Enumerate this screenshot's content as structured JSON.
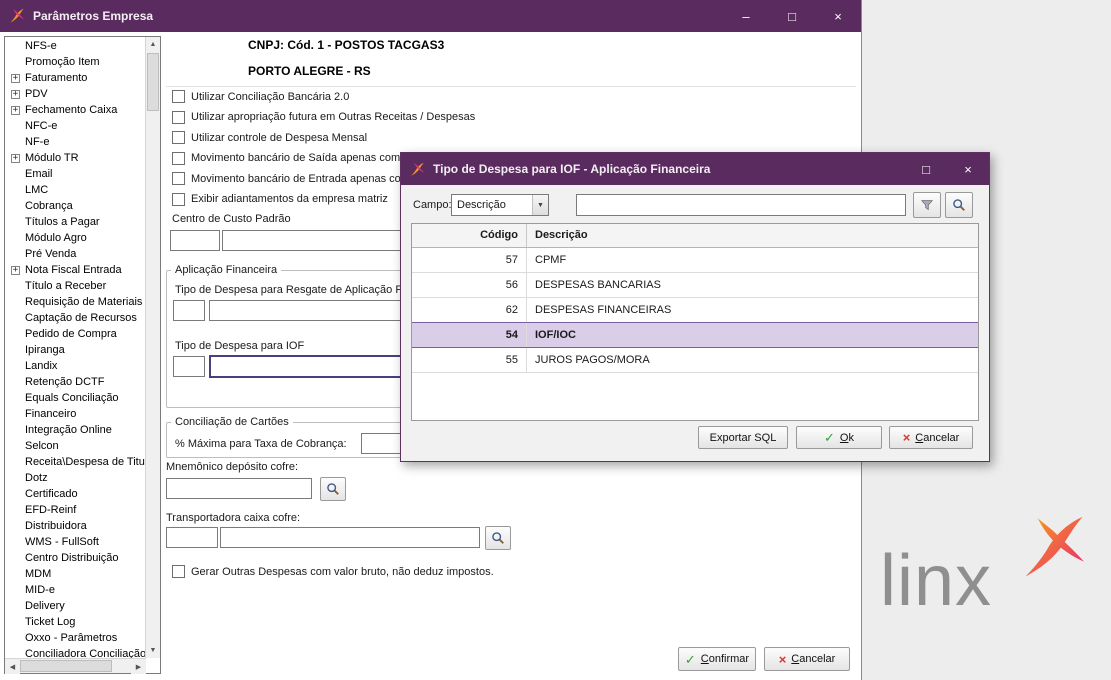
{
  "window": {
    "title": "Parâmetros Empresa",
    "minimize": "–",
    "maximize": "□",
    "close": "×"
  },
  "sidebar": {
    "items": [
      {
        "label": "NFS-e",
        "plus": false
      },
      {
        "label": "Promoção Item",
        "plus": false
      },
      {
        "label": "Faturamento",
        "plus": true
      },
      {
        "label": "PDV",
        "plus": true
      },
      {
        "label": "Fechamento Caixa",
        "plus": true
      },
      {
        "label": "NFC-e",
        "plus": false
      },
      {
        "label": "NF-e",
        "plus": false
      },
      {
        "label": "Módulo TR",
        "plus": true
      },
      {
        "label": "Email",
        "plus": false
      },
      {
        "label": "LMC",
        "plus": false
      },
      {
        "label": "Cobrança",
        "plus": false
      },
      {
        "label": "Títulos a Pagar",
        "plus": false
      },
      {
        "label": "Módulo Agro",
        "plus": false
      },
      {
        "label": "Pré Venda",
        "plus": false
      },
      {
        "label": "Nota Fiscal Entrada",
        "plus": true
      },
      {
        "label": "Título a Receber",
        "plus": false
      },
      {
        "label": "Requisição de Materiais",
        "plus": false
      },
      {
        "label": "Captação de Recursos",
        "plus": false
      },
      {
        "label": "Pedido de Compra",
        "plus": false
      },
      {
        "label": "Ipiranga",
        "plus": false
      },
      {
        "label": "Landix",
        "plus": false
      },
      {
        "label": "Retenção DCTF",
        "plus": false
      },
      {
        "label": "Equals Conciliação",
        "plus": false
      },
      {
        "label": "Financeiro",
        "plus": false
      },
      {
        "label": "Integração Online",
        "plus": false
      },
      {
        "label": "Selcon",
        "plus": false
      },
      {
        "label": "Receita\\Despesa de Titul",
        "plus": false
      },
      {
        "label": "Dotz",
        "plus": false
      },
      {
        "label": "Certificado",
        "plus": false
      },
      {
        "label": "EFD-Reinf",
        "plus": false
      },
      {
        "label": "Distribuidora",
        "plus": false
      },
      {
        "label": "WMS - FullSoft",
        "plus": false
      },
      {
        "label": "Centro Distribuição",
        "plus": false
      },
      {
        "label": "MDM",
        "plus": false
      },
      {
        "label": "MID-e",
        "plus": false
      },
      {
        "label": "Delivery",
        "plus": false
      },
      {
        "label": "Ticket Log",
        "plus": false
      },
      {
        "label": "Oxxo - Parâmetros",
        "plus": false
      },
      {
        "label": "Conciliadora Conciliação",
        "plus": false
      }
    ]
  },
  "form": {
    "cnpj_line": "CNPJ: Cód. 1 - POSTOS TACGAS3",
    "city_line": "PORTO ALEGRE - RS",
    "checkboxes": [
      "Utilizar Conciliação Bancária 2.0",
      "Utilizar apropriação futura em Outras Receitas / Despesas",
      "Utilizar controle de Despesa Mensal",
      "Movimento bancário de Saída apenas com co",
      "Movimento bancário de Entrada apenas com",
      "Exibir adiantamentos da empresa matriz"
    ],
    "centro_custo_label": "Centro de Custo Padrão",
    "aplicacao_financeira": {
      "legend": "Aplicação Financeira",
      "resgate_label": "Tipo de Despesa para Resgate de Aplicação F",
      "iof_label": "Tipo de Despesa para IOF"
    },
    "conciliacao_cartoes": {
      "legend": "Conciliação de Cartões",
      "taxa_label": "% Máxima para Taxa de Cobrança:"
    },
    "mnemonico_label": "Mnemônico depósito cofre:",
    "transportadora_label": "Transportadora caixa cofre:",
    "gerar_outras_label": "Gerar Outras Despesas com valor bruto, não deduz impostos.",
    "confirm_button": "Confirmar",
    "cancel_button": "Cancelar"
  },
  "dialog": {
    "title": "Tipo de Despesa para IOF - Aplicação Financeira",
    "campo_label": "Campo:",
    "campo_value": "Descrição",
    "search_value": "",
    "table": {
      "headers": [
        "Código",
        "Descrição"
      ],
      "rows": [
        {
          "codigo": "57",
          "descricao": "CPMF",
          "selected": false
        },
        {
          "codigo": "56",
          "descricao": "DESPESAS BANCARIAS",
          "selected": false
        },
        {
          "codigo": "62",
          "descricao": "DESPESAS FINANCEIRAS",
          "selected": false
        },
        {
          "codigo": "54",
          "descricao": "IOF/IOC",
          "selected": true
        },
        {
          "codigo": "55",
          "descricao": "JUROS PAGOS/MORA",
          "selected": false
        }
      ]
    },
    "export_button": "Exportar SQL",
    "ok_button": "Ok",
    "cancel_button": "Cancelar"
  },
  "logo": {
    "text": "linx"
  }
}
